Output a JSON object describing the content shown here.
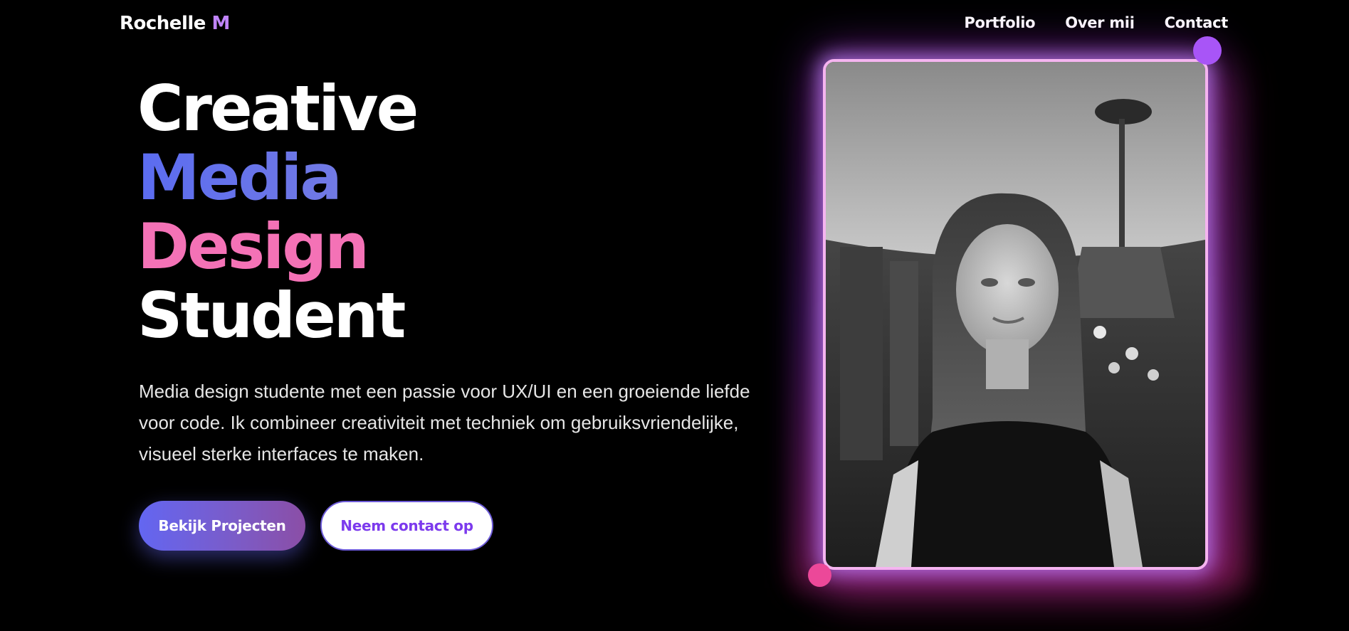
{
  "nav": {
    "brand_name": "Rochelle",
    "brand_accent": "M",
    "links": [
      "Portfolio",
      "Over mij",
      "Contact"
    ]
  },
  "hero": {
    "title_lines": [
      "Creative",
      "Media",
      "Design",
      "Student"
    ],
    "description": "Media design studente met een passie voor UX/UI en een groeiende liefde voor code. Ik combineer creativiteit met techniek om gebruiksvriendelijke, visueel sterke interfaces te maken.",
    "primary_button": "Bekijk Projecten",
    "secondary_button": "Neem contact op"
  },
  "photo": {
    "alt": "portrait photo"
  },
  "colors": {
    "background": "#000000",
    "accent_purple": "#c084fc",
    "accent_blue": "#5b6cf0",
    "accent_pink": "#f472b6",
    "frame_border": "#f5b4f0",
    "dot_purple": "#a855f7",
    "dot_pink": "#ec4899"
  }
}
